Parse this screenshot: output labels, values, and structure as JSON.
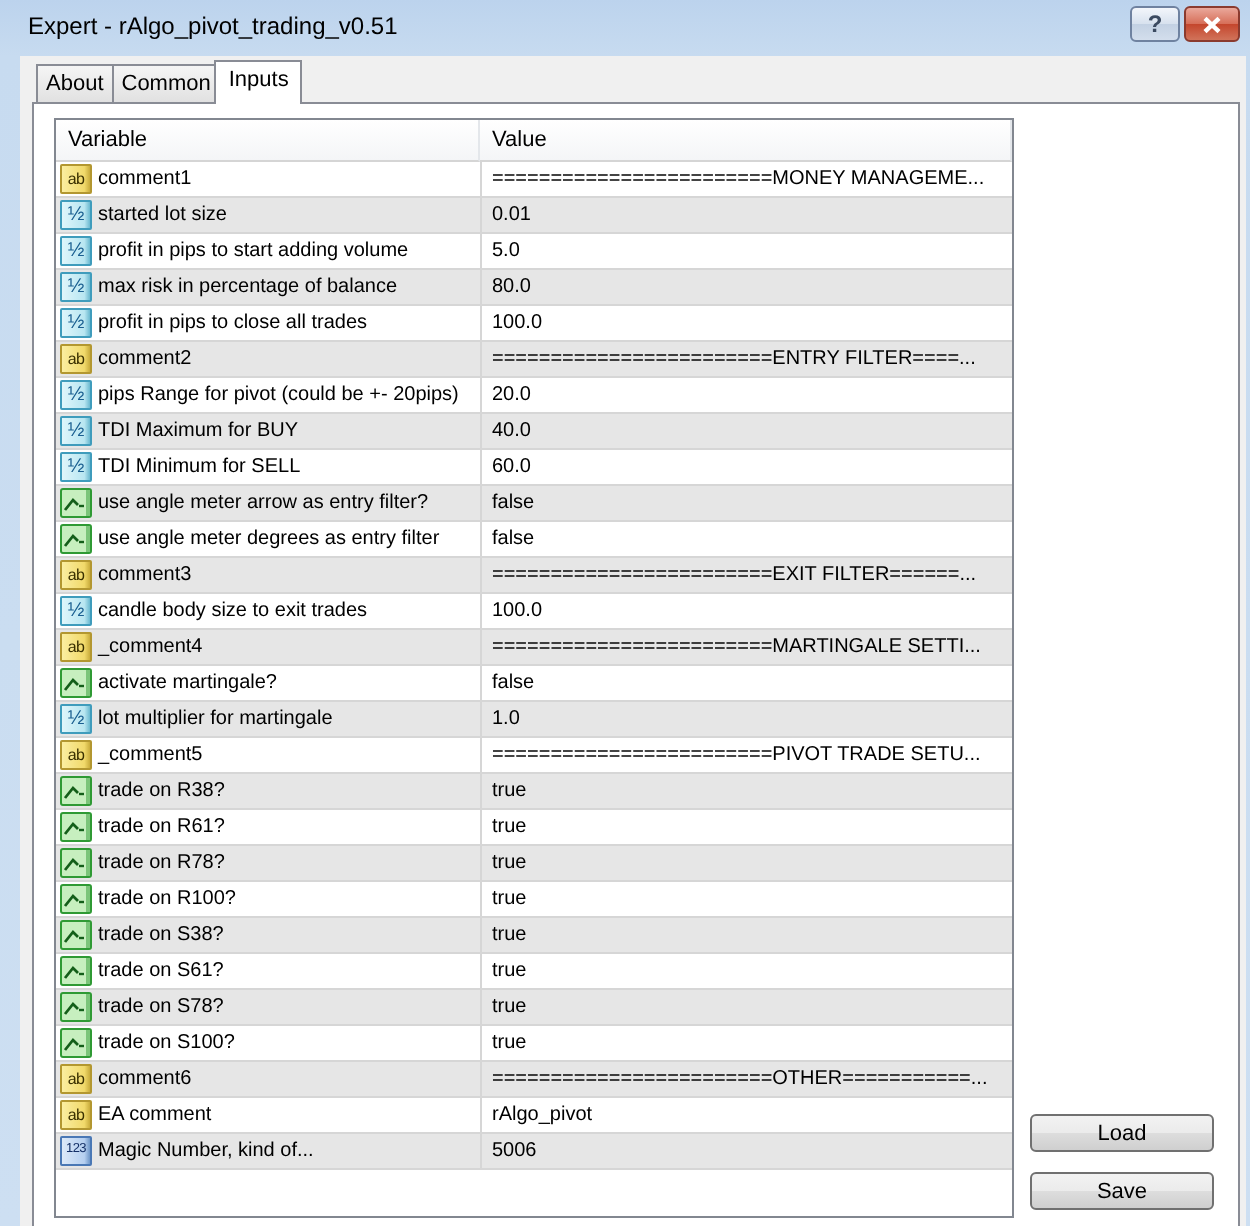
{
  "window": {
    "title": "Expert - rAlgo_pivot_trading_v0.51",
    "help_button": "?"
  },
  "tabs": [
    {
      "label": "About",
      "selected": false
    },
    {
      "label": "Common",
      "selected": false
    },
    {
      "label": "Inputs",
      "selected": true
    }
  ],
  "table": {
    "columns": [
      "Variable",
      "Value"
    ],
    "rows": [
      {
        "kind": "string",
        "type_label": "ab",
        "variable": "comment1",
        "value": "========================MONEY MANAGEME..."
      },
      {
        "kind": "double",
        "type_label": "½",
        "variable": "started lot size",
        "value": "0.01"
      },
      {
        "kind": "double",
        "type_label": "½",
        "variable": "profit in pips to start adding volume",
        "value": "5.0"
      },
      {
        "kind": "double",
        "type_label": "½",
        "variable": "max risk in percentage of balance",
        "value": "80.0"
      },
      {
        "kind": "double",
        "type_label": "½",
        "variable": "profit in pips to close all trades",
        "value": "100.0"
      },
      {
        "kind": "string",
        "type_label": "ab",
        "variable": "comment2",
        "value": "========================ENTRY FILTER====..."
      },
      {
        "kind": "double",
        "type_label": "½",
        "variable": "pips Range for pivot (could be +- 20pips)",
        "value": "20.0"
      },
      {
        "kind": "double",
        "type_label": "½",
        "variable": "TDI Maximum for BUY",
        "value": "40.0"
      },
      {
        "kind": "double",
        "type_label": "½",
        "variable": "TDI Minimum for SELL",
        "value": "60.0"
      },
      {
        "kind": "bool",
        "variable": "use angle meter arrow as entry filter?",
        "value": "false"
      },
      {
        "kind": "bool",
        "variable": "use angle meter degrees as entry filter",
        "value": "false"
      },
      {
        "kind": "string",
        "type_label": "ab",
        "variable": "comment3",
        "value": "========================EXIT FILTER======..."
      },
      {
        "kind": "double",
        "type_label": "½",
        "variable": "candle body size to exit trades",
        "value": "100.0"
      },
      {
        "kind": "string",
        "type_label": "ab",
        "variable": "_comment4",
        "value": "========================MARTINGALE SETTI..."
      },
      {
        "kind": "bool",
        "variable": "activate martingale?",
        "value": "false"
      },
      {
        "kind": "double",
        "type_label": "½",
        "variable": "lot multiplier for martingale",
        "value": "1.0"
      },
      {
        "kind": "string",
        "type_label": "ab",
        "variable": "_comment5",
        "value": "========================PIVOT TRADE SETU..."
      },
      {
        "kind": "bool",
        "variable": "trade on R38?",
        "value": "true"
      },
      {
        "kind": "bool",
        "variable": "trade on R61?",
        "value": "true"
      },
      {
        "kind": "bool",
        "variable": "trade on R78?",
        "value": "true"
      },
      {
        "kind": "bool",
        "variable": "trade on R100?",
        "value": "true"
      },
      {
        "kind": "bool",
        "variable": "trade on S38?",
        "value": "true"
      },
      {
        "kind": "bool",
        "variable": "trade on S61?",
        "value": "true"
      },
      {
        "kind": "bool",
        "variable": "trade on S78?",
        "value": "true"
      },
      {
        "kind": "bool",
        "variable": "trade on S100?",
        "value": "true"
      },
      {
        "kind": "string",
        "type_label": "ab",
        "variable": "comment6",
        "value": "========================OTHER===========..."
      },
      {
        "kind": "string",
        "type_label": "ab",
        "variable": "EA comment",
        "value": "rAlgo_pivot"
      },
      {
        "kind": "int",
        "type_label": "123",
        "variable": "Magic Number, kind of...",
        "value": "5006"
      }
    ]
  },
  "buttons": [
    "Load",
    "Save"
  ]
}
